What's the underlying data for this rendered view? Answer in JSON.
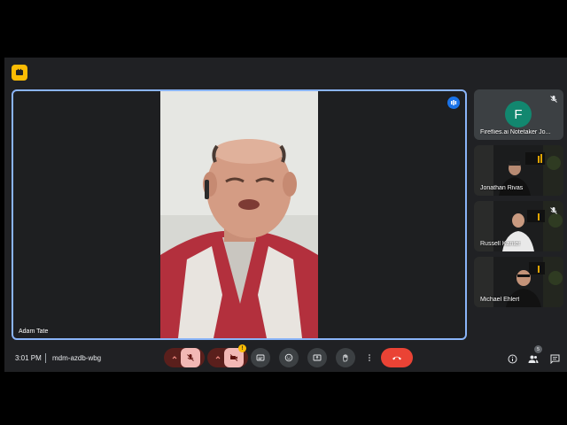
{
  "meeting": {
    "time": "3:01 PM",
    "code": "mdm-azdb-wbg",
    "participant_count": "5"
  },
  "stage": {
    "speaker_name": "Adam Tate"
  },
  "tiles": [
    {
      "name": "Fireflies.ai Notetaker Jo...",
      "initial": "F",
      "muted": true
    },
    {
      "name": "Jonathan Rivas",
      "muted": false
    },
    {
      "name": "Russell Kanter",
      "muted": true
    },
    {
      "name": "Michael Ehlert",
      "muted": false
    }
  ],
  "colors": {
    "meet_bg": "#202124",
    "active_border": "#8ab4f8",
    "end_call": "#ea4335",
    "muted_button": "#f2b8b5",
    "avatar_green": "#12876f",
    "activity_yellow": "#fbbc04"
  },
  "controls": {
    "icons": [
      "mic-off-icon",
      "camera-off-icon",
      "captions-icon",
      "emoji-icon",
      "present-icon",
      "raise-hand-icon",
      "more-options-icon",
      "end-call-icon"
    ],
    "right_icons": [
      "info-icon",
      "people-icon",
      "chat-icon"
    ]
  }
}
